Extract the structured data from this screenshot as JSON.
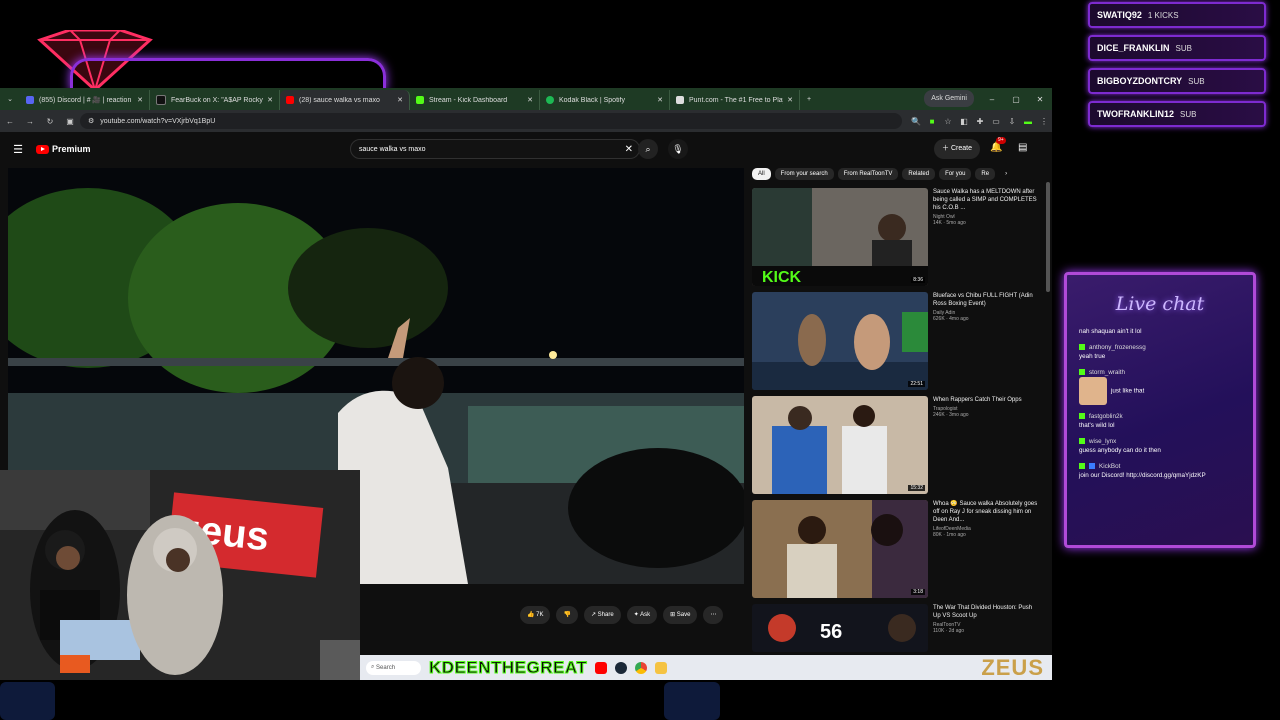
{
  "events": [
    {
      "name": "SWATIQ92",
      "type": "1 KICKS"
    },
    {
      "name": "DICE_FRANKLIN",
      "type": "SUB"
    },
    {
      "name": "BIGBOYZDONTCRY",
      "type": "SUB"
    },
    {
      "name": "TWOFRANKLIN12",
      "type": "SUB"
    }
  ],
  "browser": {
    "tabs": [
      {
        "label": "(855) Discord | # 🎥 | reaction",
        "color": "#5865f2"
      },
      {
        "label": "FearBuck on X: \"A$AP Rocky g",
        "color": "#000000"
      },
      {
        "label": "(28) sauce walka vs maxo",
        "color": "#ff0000"
      },
      {
        "label": "Stream - Kick Dashboard",
        "color": "#53fc18"
      },
      {
        "label": "Kodak Black | Spotify",
        "color": "#1db954"
      },
      {
        "label": "Punt.com - The #1 Free to Play",
        "color": "#ffffff"
      }
    ],
    "ask_gemini": "Ask Gemini",
    "url": "youtube.com/watch?v=VXjrbVq1BpU"
  },
  "youtube": {
    "logo": "Premium",
    "search_value": "sauce walka vs maxo",
    "create_label": "Create",
    "notif_count": "9+",
    "chips": [
      "All",
      "From your search",
      "From RealToonTV",
      "Related",
      "For you",
      "Re"
    ],
    "actions": {
      "like": "7K",
      "share": "Share",
      "ask": "Ask",
      "save": "Save"
    },
    "recommendations": [
      {
        "title": "Sauce Walka has a MELTDOWN after being called a SIMP and COMPLETES his C.O.B ...",
        "channel": "Night Owl",
        "views": "14K · 5mo ago",
        "duration": "8:36"
      },
      {
        "title": "Blueface vs Chibu FULL FIGHT (Adin Ross Boxing Event)",
        "channel": "Daily Adin",
        "views": "626K · 4mo ago",
        "duration": "22:51"
      },
      {
        "title": "When Rappers Catch Their Opps",
        "channel": "Trapologist",
        "views": "246K · 3mo ago",
        "duration": "15:32"
      },
      {
        "title": "Whoa 😳 Sauce walka Absolutely goes off on Ray J for sneak dissing him on Deen And...",
        "channel": "LifeofDeenMedia",
        "views": "80K · 1mo ago",
        "duration": "3:18"
      },
      {
        "title": "The War That Divided Houston: Push Up VS Scoot Up",
        "channel": "RealToonTV",
        "views": "110K · 2d ago",
        "duration": ""
      }
    ]
  },
  "taskbar": {
    "search_placeholder": "Search",
    "kick_name": "KDEENTHEGREAT",
    "zeus_logo": "ZEUS"
  },
  "overlay": {
    "cam_banner": "zeus"
  },
  "chat": {
    "title": "Live chat",
    "messages": [
      {
        "user": "",
        "text": "nah shaquan ain't it lol"
      },
      {
        "user": "anthony_frozenessg",
        "text": "yeah true"
      },
      {
        "user": "storm_wraith",
        "text": "just like that"
      },
      {
        "user": "fastgoblin2k",
        "text": "that's wild lol"
      },
      {
        "user": "wise_lynx",
        "text": "guess anybody can do it then"
      },
      {
        "user": "KickBot",
        "text": "join our Discord! http://discord.gg/qmaYjdzKP"
      }
    ]
  }
}
